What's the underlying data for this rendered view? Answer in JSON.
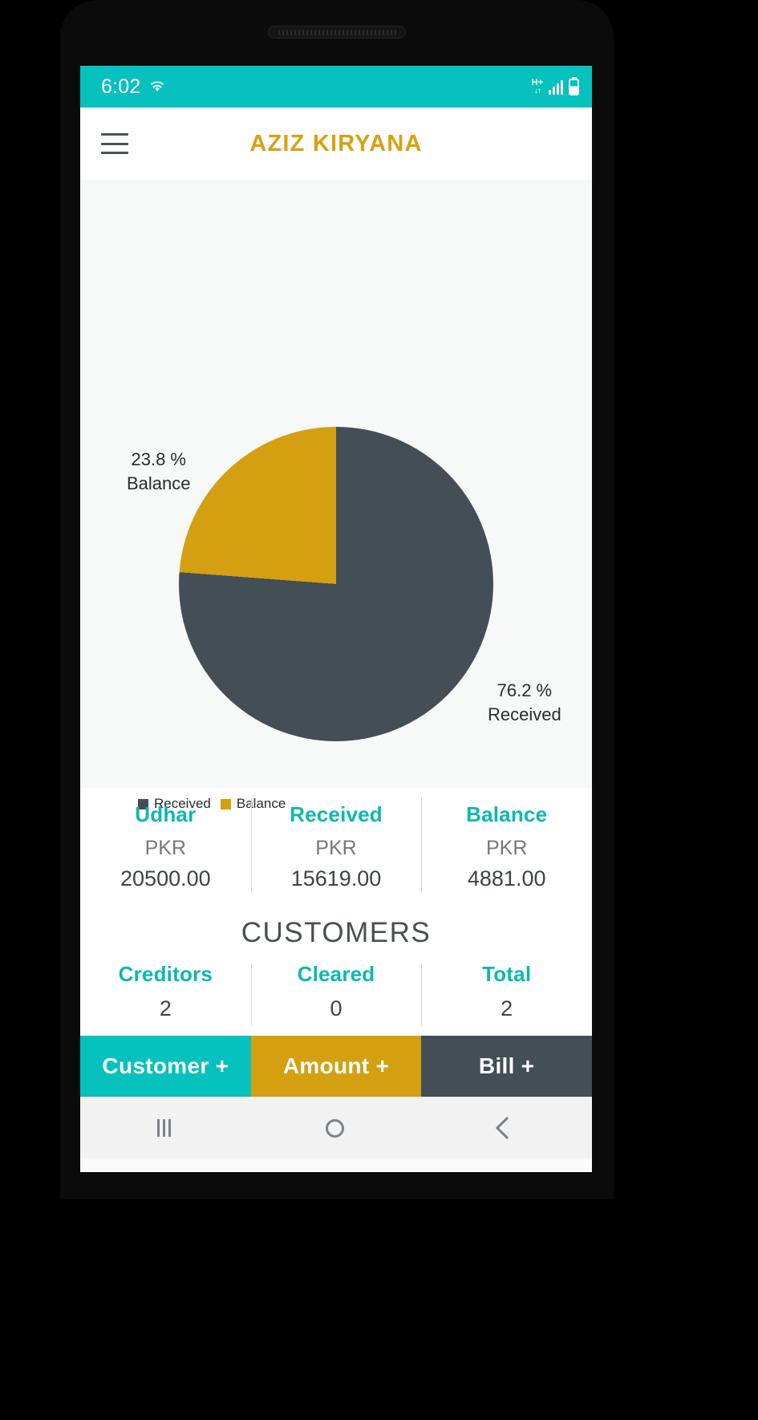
{
  "status_bar": {
    "time": "6:02",
    "wifi_icon": "wifi-icon",
    "network_label_top": "H+",
    "network_label_bottom": "↓↑",
    "signal_icon": "signal-bars-icon",
    "battery_icon": "battery-icon"
  },
  "app_bar": {
    "menu_icon": "hamburger-menu-icon",
    "title": "AZIZ KIRYANA"
  },
  "chart_data": {
    "type": "pie",
    "title": "",
    "categories": [
      "Received",
      "Balance"
    ],
    "values": [
      76.2,
      23.8
    ],
    "value_labels": [
      "76.2 %",
      "23.8 %"
    ],
    "colors": [
      "#434e57",
      "#d4a012"
    ],
    "legend": [
      {
        "label": "Received",
        "color": "#434e57"
      },
      {
        "label": "Balance",
        "color": "#d4a012"
      }
    ],
    "legend_position": "bottom-left",
    "annotations": [
      {
        "text_value": "23.8 %",
        "text_name": "Balance",
        "position": "left"
      },
      {
        "text_value": "76.2 %",
        "text_name": "Received",
        "position": "right"
      }
    ]
  },
  "pie_labels": {
    "left_percent": "23.8 %",
    "left_name": "Balance",
    "right_percent": "76.2 %",
    "right_name": "Received"
  },
  "legend": {
    "received": "Received",
    "balance": "Balance"
  },
  "amounts": {
    "columns": [
      {
        "title": "Udhar",
        "currency": "PKR",
        "value": "20500.00"
      },
      {
        "title": "Received",
        "currency": "PKR",
        "value": "15619.00"
      },
      {
        "title": "Balance",
        "currency": "PKR",
        "value": "4881.00"
      }
    ]
  },
  "customers": {
    "heading": "CUSTOMERS",
    "columns": [
      {
        "title": "Creditors",
        "value": "2"
      },
      {
        "title": "Cleared",
        "value": "0"
      },
      {
        "title": "Total",
        "value": "2"
      }
    ]
  },
  "actions": [
    {
      "label": "Customer +",
      "color": "#06c1bd"
    },
    {
      "label": "Amount +",
      "color": "#d4a012"
    },
    {
      "label": "Bill +",
      "color": "#434e57"
    }
  ],
  "nav_bar": {
    "recent_icon": "recent-apps-icon",
    "home_icon": "home-icon",
    "back_icon": "back-icon"
  },
  "colors": {
    "teal": "#06c1bd",
    "gold": "#d4a012",
    "slate": "#434e57"
  }
}
